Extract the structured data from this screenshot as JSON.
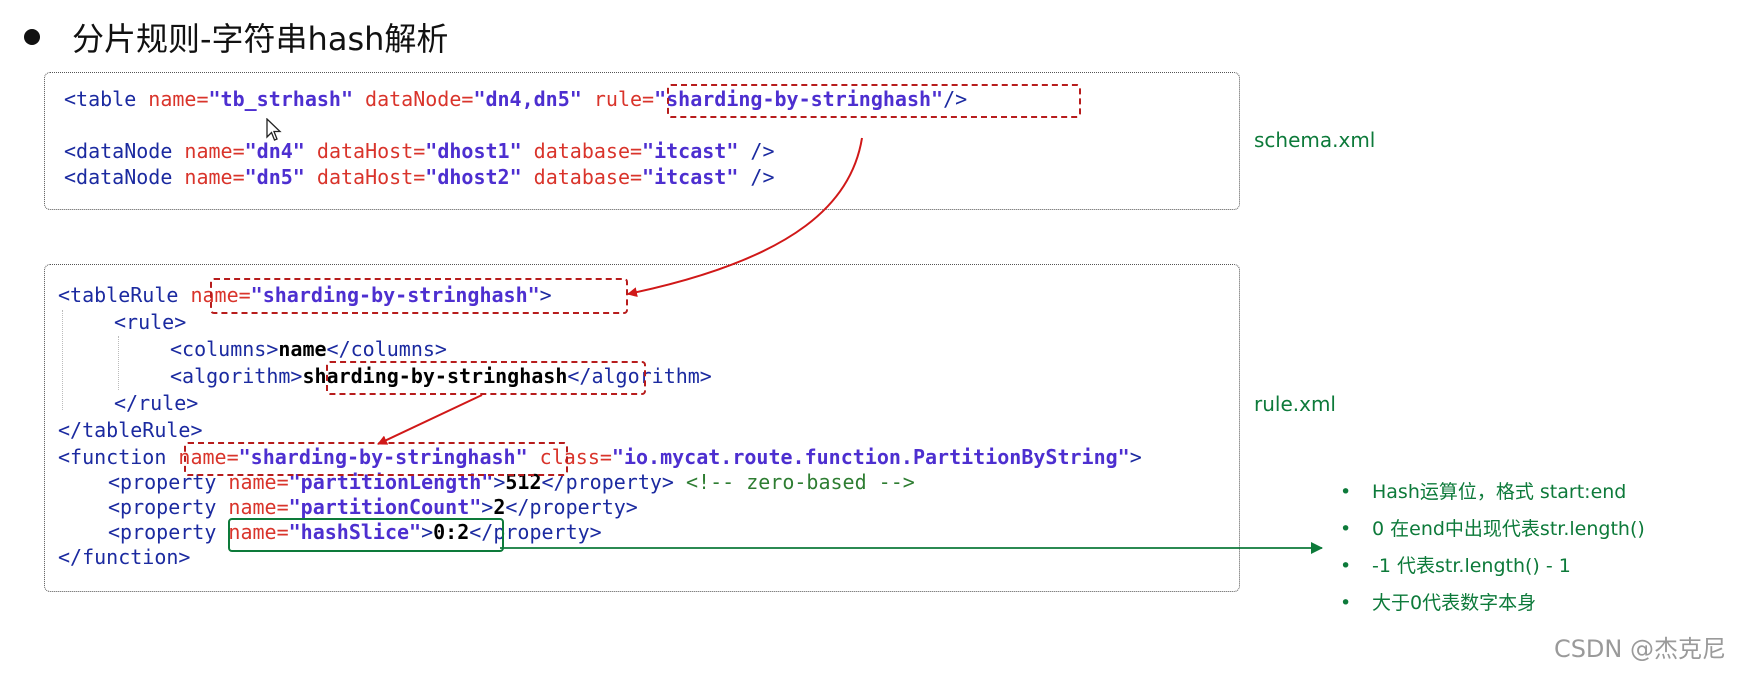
{
  "heading": {
    "bullet": "●",
    "title": "分片规则-字符串hash解析"
  },
  "schema": {
    "file_label": "schema.xml",
    "line1": {
      "open": "<table ",
      "name_attr": "name=",
      "name_val": "\"tb_strhash\"",
      "datanode_attr": " dataNode=",
      "datanode_val": "\"dn4,dn5\"",
      "rule_attr": "rule=",
      "rule_val": "\"sharding-by-stringhash\"",
      "close": "/>"
    },
    "line2": {
      "open": "<dataNode ",
      "name_attr": "name=",
      "name_val": "\"dn4\"",
      "host_attr": " dataHost=",
      "host_val": "\"dhost1\"",
      "db_attr": " database=",
      "db_val": "\"itcast\"",
      "close": " />"
    },
    "line3": {
      "open": "<dataNode ",
      "name_attr": "name=",
      "name_val": "\"dn5\"",
      "host_attr": " dataHost=",
      "host_val": "\"dhost2\"",
      "db_attr": " database=",
      "db_val": "\"itcast\"",
      "close": " />"
    }
  },
  "rule": {
    "file_label": "rule.xml",
    "tablerule_open": "<tableRule ",
    "tablerule_name_attr": "name=",
    "tablerule_name_val": "\"sharding-by-stringhash\"",
    "tablerule_open_end": ">",
    "rule_open": "<rule>",
    "columns_open": "<columns>",
    "columns_val": "name",
    "columns_close": "</columns>",
    "algorithm_open": "<algorithm>",
    "algorithm_val": "sharding-by-stringhash",
    "algorithm_close": "</algorithm>",
    "rule_close": "</rule>",
    "tablerule_close": "</tableRule>",
    "function_open": "<function ",
    "function_name_attr": "name=",
    "function_name_val": "\"sharding-by-stringhash\"",
    "function_class_attr": " class=",
    "function_class_val": "\"io.mycat.route.function.PartitionByString\"",
    "function_open_end": ">",
    "prop1_open": "<property ",
    "prop1_attr": "name=",
    "prop1_val": "\"partitionLength\"",
    "prop1_gt": ">",
    "prop1_text": "512",
    "prop1_close": "</property>",
    "prop1_comment": " <!-- zero-based -->",
    "prop2_open": "<property ",
    "prop2_attr": "name=",
    "prop2_val": "\"partitionCount\"",
    "prop2_gt": ">",
    "prop2_text": "2",
    "prop2_close": "</property>",
    "prop3_open": "<property ",
    "prop3_attr": "name=",
    "prop3_val": "\"hashSlice\"",
    "prop3_gt": ">",
    "prop3_text": "0:2",
    "prop3_close": "</property>",
    "function_close": "</function>"
  },
  "notes": {
    "bullet": "•",
    "items": [
      "Hash运算位，格式 start:end",
      "0 在end中出现代表str.length()",
      "-1 代表str.length() - 1",
      "大于0代表数字本身"
    ]
  },
  "watermark": "CSDN @杰克尼",
  "colors": {
    "tag": "#1b2aa0",
    "attr": "#d9342b",
    "value": "#4d2fd0",
    "highlight_red": "#b71c1c",
    "annotation_green": "#0d7a3a"
  },
  "icons": [
    "arrow-pointer-cursor-icon"
  ]
}
